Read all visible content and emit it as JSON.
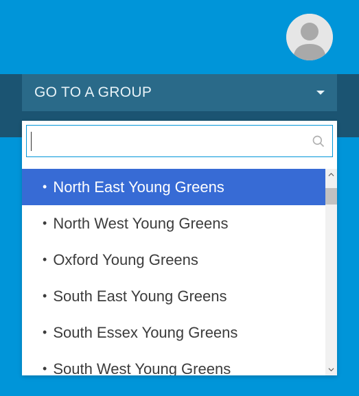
{
  "avatar": {
    "name": "user-avatar"
  },
  "dropdown": {
    "label": "GO TO A GROUP",
    "search_value": "",
    "search_placeholder": "",
    "selected_index": 0,
    "options": [
      "North East Young Greens",
      "North West Young Greens",
      "Oxford Young Greens",
      "South East Young Greens",
      "South Essex Young Greens",
      "South West Young Greens"
    ]
  },
  "colors": {
    "brand_bg": "#0095d9",
    "band_dark": "#1b5472",
    "header_bg": "#2a6a89",
    "selected_bg": "#376bd5"
  }
}
